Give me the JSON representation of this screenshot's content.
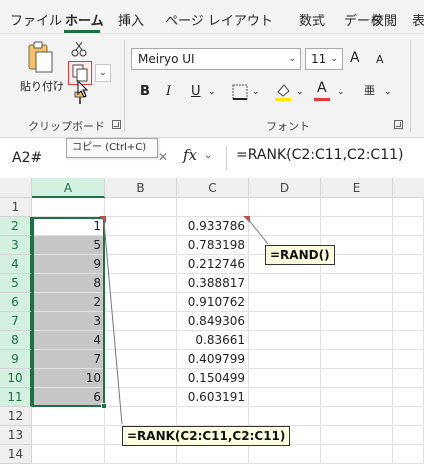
{
  "ribbon_tabs": [
    "ファイル",
    "ホーム",
    "挿入",
    "ページ レイアウト",
    "数式",
    "データ",
    "校閲",
    "表"
  ],
  "active_tab": "ホーム",
  "clipboard": {
    "paste_label": "貼り付け",
    "group_label": "クリップボード",
    "copy_tooltip": "コピー (Ctrl+C)"
  },
  "font": {
    "name": "Meiryo UI",
    "size": "11",
    "group_label": "フォント",
    "size_up": "A",
    "size_down": "A",
    "bold": "B",
    "italic": "I",
    "underline": "U",
    "font_color_letter": "A",
    "phonetic": "亜"
  },
  "formula_bar": {
    "name_box": "A2#",
    "fx": "fx",
    "formula": "=RANK(C2:C11,C2:C11)"
  },
  "grid": {
    "columns": [
      "A",
      "B",
      "C",
      "D",
      "E"
    ],
    "rows": [
      "1",
      "2",
      "3",
      "4",
      "5",
      "6",
      "7",
      "8",
      "9",
      "10",
      "11",
      "12",
      "13",
      "14"
    ],
    "col_a": [
      "",
      "1",
      "5",
      "9",
      "8",
      "2",
      "3",
      "4",
      "7",
      "10",
      "6",
      "",
      "",
      ""
    ],
    "col_c": [
      "",
      "0.933786",
      "0.783198",
      "0.212746",
      "0.388817",
      "0.910762",
      "0.849306",
      "0.83661",
      "0.409799",
      "0.150499",
      "0.603191",
      "",
      "",
      ""
    ]
  },
  "callouts": {
    "rand": "=RAND()",
    "rank": "=RANK(C2:C11,C2:C11)"
  },
  "colors": {
    "accent": "#1e7145",
    "highlight_red": "#e33b3b",
    "selection_fill": "#c6c6c6",
    "callout_bg": "#ffffe1"
  }
}
